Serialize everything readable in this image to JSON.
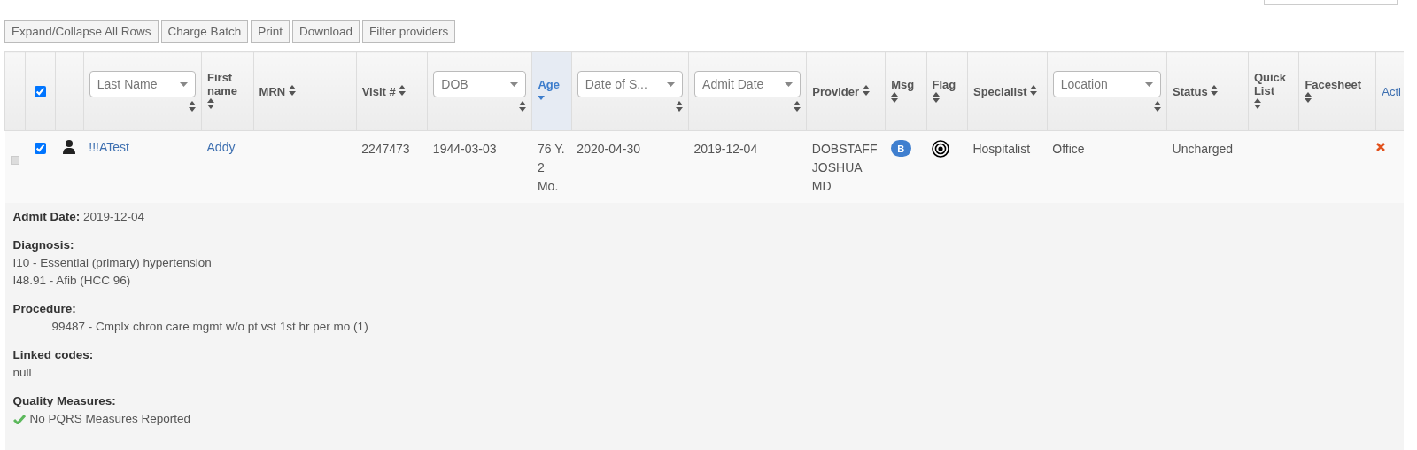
{
  "toolbar": [
    "Expand/Collapse All Rows",
    "Charge Batch",
    "Print",
    "Download",
    "Filter providers"
  ],
  "table": {
    "columns": [
      {
        "kind": "blank"
      },
      {
        "kind": "checkbox",
        "checked": true
      },
      {
        "kind": "blank"
      },
      {
        "kind": "select",
        "label": "Last Name"
      },
      {
        "kind": "sort",
        "label": "First name",
        "selected": false
      },
      {
        "kind": "sort",
        "label": "MRN",
        "selected": false
      },
      {
        "kind": "sort",
        "label": "Visit #",
        "selected": false
      },
      {
        "kind": "select",
        "label": "DOB"
      },
      {
        "kind": "sort",
        "label": "Age",
        "selected": true
      },
      {
        "kind": "select",
        "label": "Date of S..."
      },
      {
        "kind": "select",
        "label": "Admit Date"
      },
      {
        "kind": "sort",
        "label": "Provider",
        "selected": false
      },
      {
        "kind": "sort",
        "label": "Msg",
        "selected": false
      },
      {
        "kind": "sort",
        "label": "Flag",
        "selected": false
      },
      {
        "kind": "sort",
        "label": "Specialist",
        "selected": false
      },
      {
        "kind": "select",
        "label": "Location"
      },
      {
        "kind": "sort",
        "label": "Status",
        "selected": false
      },
      {
        "kind": "sort",
        "label": "Quick List",
        "selected": false
      },
      {
        "kind": "sort",
        "label": "Facesheet",
        "selected": false
      },
      {
        "kind": "link",
        "label": "Acti"
      }
    ],
    "rows": [
      {
        "expanded": true,
        "cells": [
          {
            "kind": "toggle"
          },
          {
            "kind": "checkbox",
            "checked": true
          },
          {
            "kind": "person"
          },
          {
            "kind": "link",
            "text": "!!!ATest"
          },
          {
            "kind": "link",
            "text": "Addy"
          },
          {
            "kind": "blank"
          },
          {
            "kind": "text",
            "text": "2247473"
          },
          {
            "kind": "text",
            "text": "1944-03-03"
          },
          {
            "kind": "text",
            "text": "76 Y. 2 Mo."
          },
          {
            "kind": "text",
            "text": "2020-04-30"
          },
          {
            "kind": "text",
            "text": "2019-12-04"
          },
          {
            "kind": "text",
            "text": "DOBSTAFF JOSHUA MD"
          },
          {
            "kind": "badge",
            "text": "B"
          },
          {
            "kind": "target"
          },
          {
            "kind": "text",
            "text": "Hospitalist"
          },
          {
            "kind": "text",
            "text": "Office"
          },
          {
            "kind": "text",
            "text": "Uncharged"
          },
          {
            "kind": "blank"
          },
          {
            "kind": "blank"
          },
          {
            "kind": "delete"
          }
        ],
        "details": [
          {
            "label": "Admit Date:",
            "inline": true,
            "lines": [
              {
                "kind": "plain",
                "text": "2019-12-04"
              }
            ]
          },
          {
            "label": "Diagnosis:",
            "inline": false,
            "lines": [
              {
                "kind": "plain",
                "text": "I10 - Essential (primary) hypertension"
              },
              {
                "kind": "plain",
                "text": "I48.91 - Afib (HCC 96)"
              }
            ]
          },
          {
            "label": "Procedure:",
            "inline": false,
            "lines": [
              {
                "kind": "indented",
                "text": "99487 - Cmplx chron care mgmt w/o pt vst 1st hr per mo (1)"
              }
            ]
          },
          {
            "label": "Linked codes:",
            "inline": false,
            "lines": [
              {
                "kind": "plain",
                "text": "null"
              }
            ]
          },
          {
            "label": "Quality Measures:",
            "inline": false,
            "lines": [
              {
                "kind": "check",
                "text": "No PQRS Measures Reported"
              }
            ]
          }
        ]
      }
    ]
  }
}
